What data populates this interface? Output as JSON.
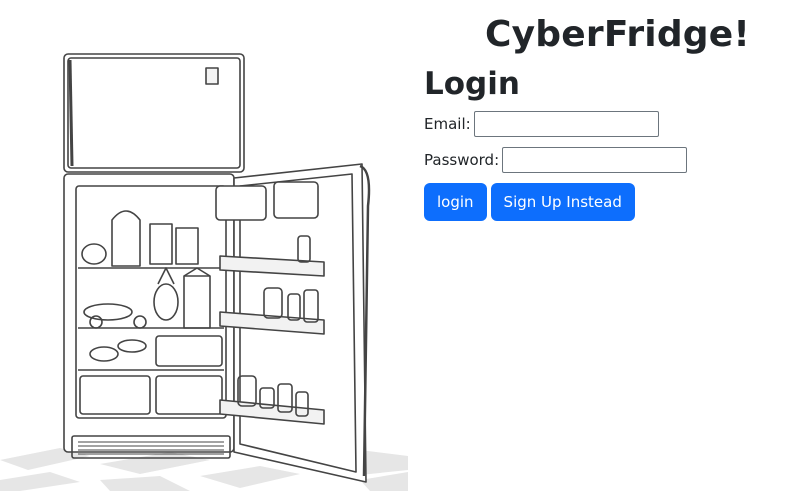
{
  "app": {
    "title": "CyberFridge!"
  },
  "login": {
    "heading": "Login",
    "email_label": "Email:",
    "email_value": "",
    "password_label": "Password:",
    "password_value": "",
    "login_button": "login",
    "signup_button": "Sign Up Instead"
  },
  "colors": {
    "primary": "#0d6efd",
    "text": "#212529",
    "background": "#ffffff"
  }
}
